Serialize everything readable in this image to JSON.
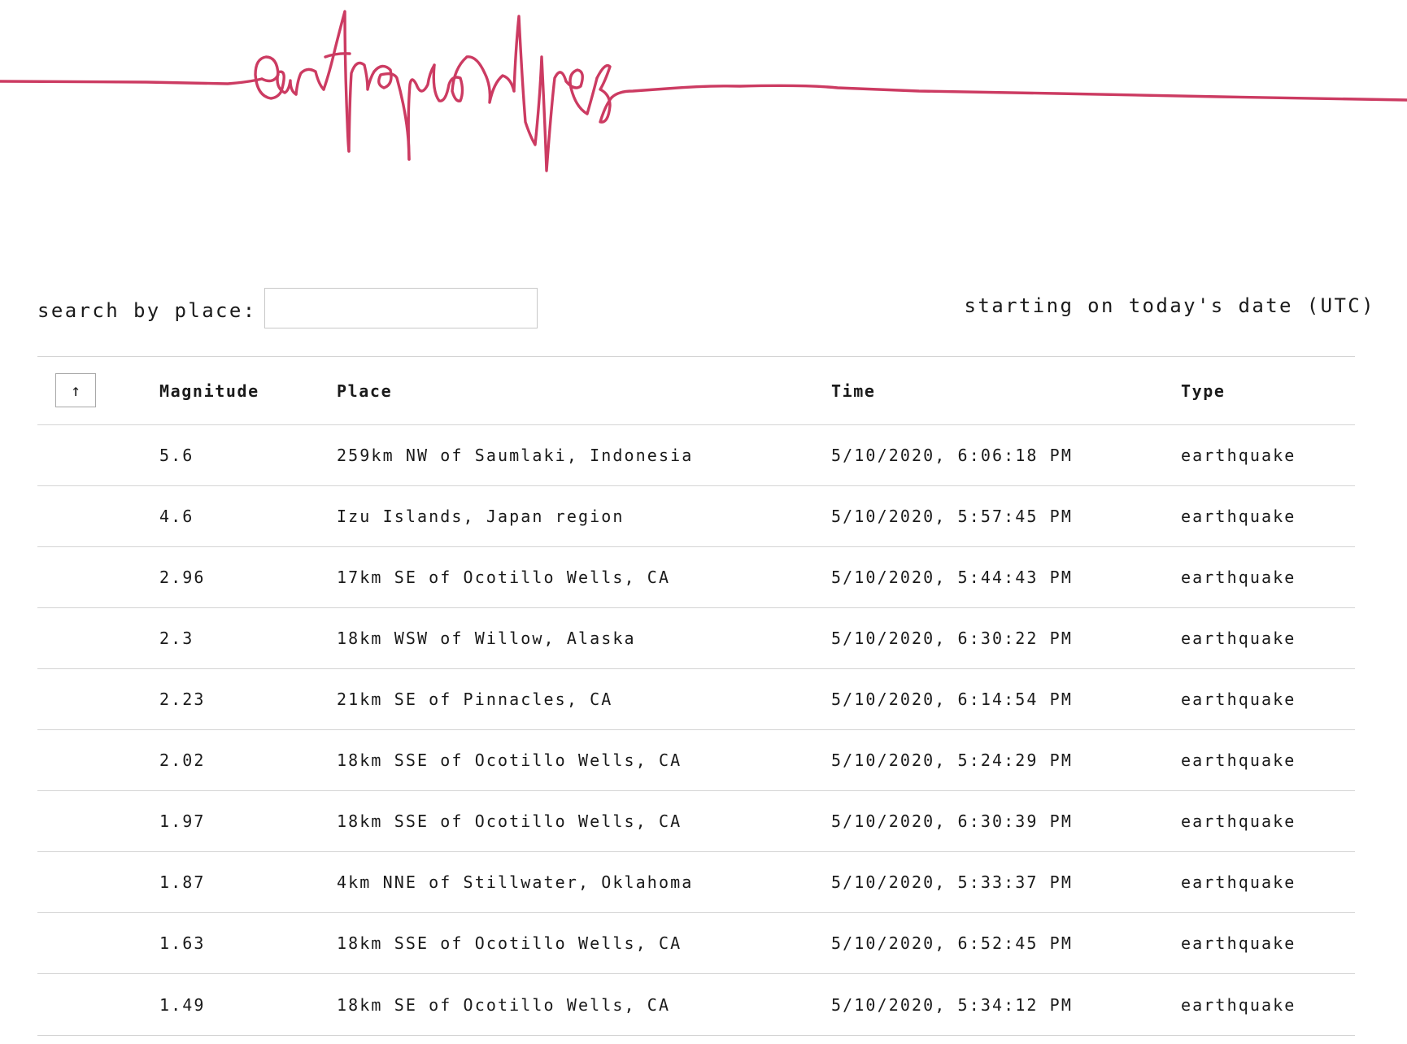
{
  "header": {
    "logo_text": "earthquakes",
    "line_color": "#cc3b62"
  },
  "search": {
    "label": "search by place:",
    "value": "",
    "placeholder": ""
  },
  "date_note": "starting on today's date (UTC)",
  "table": {
    "sort_icon": "arrow-up-icon",
    "sort_glyph": "↑",
    "columns": [
      "Magnitude",
      "Place",
      "Time",
      "Type"
    ],
    "rows": [
      {
        "magnitude": "5.6",
        "place": "259km NW of Saumlaki, Indonesia",
        "time": "5/10/2020, 6:06:18 PM",
        "type": "earthquake"
      },
      {
        "magnitude": "4.6",
        "place": "Izu Islands, Japan region",
        "time": "5/10/2020, 5:57:45 PM",
        "type": "earthquake"
      },
      {
        "magnitude": "2.96",
        "place": "17km SE of Ocotillo Wells, CA",
        "time": "5/10/2020, 5:44:43 PM",
        "type": "earthquake"
      },
      {
        "magnitude": "2.3",
        "place": "18km WSW of Willow, Alaska",
        "time": "5/10/2020, 6:30:22 PM",
        "type": "earthquake"
      },
      {
        "magnitude": "2.23",
        "place": "21km SE of Pinnacles, CA",
        "time": "5/10/2020, 6:14:54 PM",
        "type": "earthquake"
      },
      {
        "magnitude": "2.02",
        "place": "18km SSE of Ocotillo Wells, CA",
        "time": "5/10/2020, 5:24:29 PM",
        "type": "earthquake"
      },
      {
        "magnitude": "1.97",
        "place": "18km SSE of Ocotillo Wells, CA",
        "time": "5/10/2020, 6:30:39 PM",
        "type": "earthquake"
      },
      {
        "magnitude": "1.87",
        "place": "4km NNE of Stillwater, Oklahoma",
        "time": "5/10/2020, 5:33:37 PM",
        "type": "earthquake"
      },
      {
        "magnitude": "1.63",
        "place": "18km SSE of Ocotillo Wells, CA",
        "time": "5/10/2020, 6:52:45 PM",
        "type": "earthquake"
      },
      {
        "magnitude": "1.49",
        "place": "18km SE of Ocotillo Wells, CA",
        "time": "5/10/2020, 5:34:12 PM",
        "type": "earthquake"
      }
    ]
  }
}
